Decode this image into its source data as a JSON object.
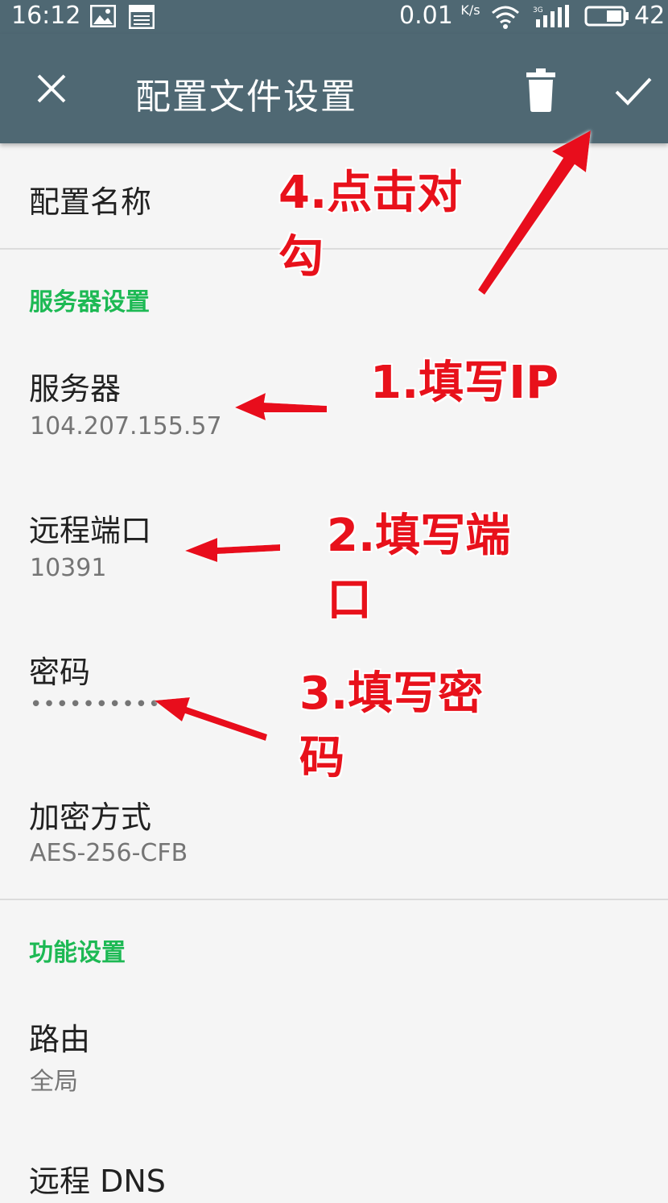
{
  "status_bar": {
    "time": "16:12",
    "net_speed": "0.01",
    "net_speed_unit": "K/s",
    "battery": "42",
    "icons": [
      "image-icon",
      "news-icon",
      "wifi-icon",
      "3g-signal-icon",
      "battery-icon"
    ]
  },
  "app_bar": {
    "title": "配置文件设置",
    "icons": {
      "close": "close-icon",
      "delete": "trash-icon",
      "confirm": "check-icon"
    },
    "background": "#4f6873"
  },
  "prefs": {
    "profile_name": {
      "label": "配置名称"
    },
    "server_category": "服务器设置",
    "server": {
      "label": "服务器",
      "value": "104.207.155.57"
    },
    "remote_port": {
      "label": "远程端口",
      "value": "10391"
    },
    "password": {
      "label": "密码",
      "value": "•••••••••••"
    },
    "encryption": {
      "label": "加密方式",
      "value": "AES-256-CFB"
    },
    "feature_category": "功能设置",
    "route": {
      "label": "路由",
      "value": "全局"
    },
    "remote_dns": {
      "label": "远程 DNS"
    }
  },
  "annotations": {
    "step1": "1.填写IP",
    "step2": "2.填写端\n口",
    "step3": "3.填写密\n码",
    "step4": "4.点击对\n勾",
    "color": "#e8111b"
  },
  "colors": {
    "accent": "#1db954",
    "toolbar": "#4f6873",
    "background": "#f5f5f5"
  }
}
